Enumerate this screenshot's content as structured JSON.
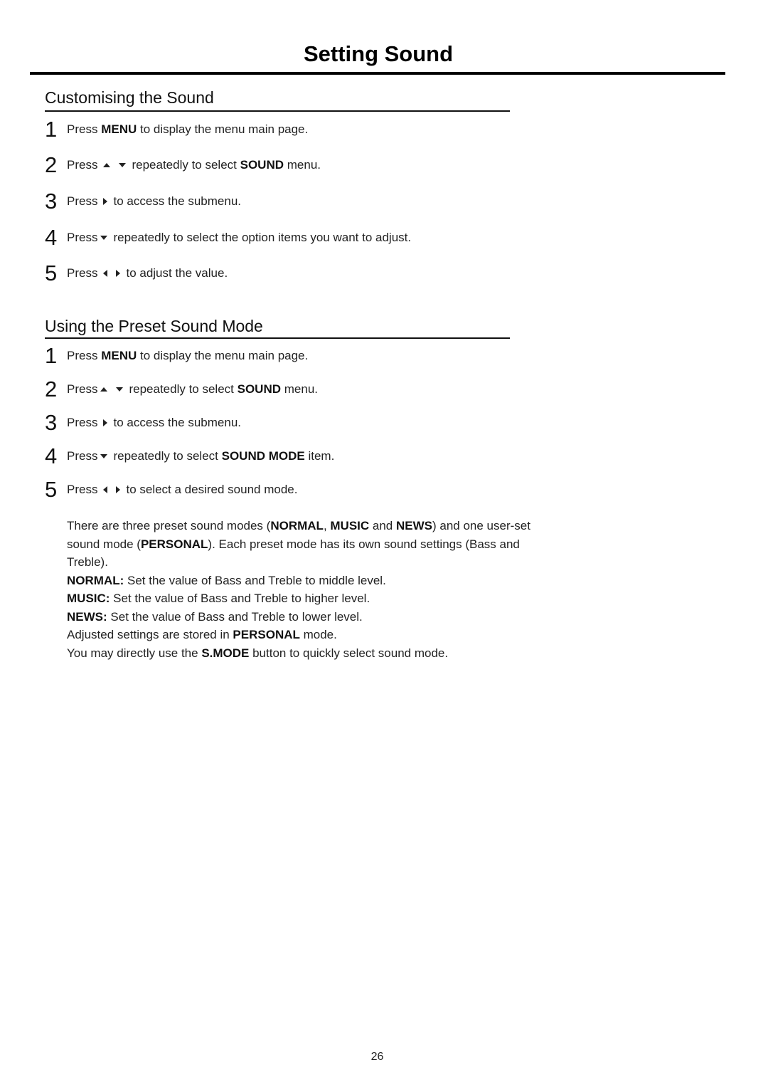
{
  "page": {
    "title": "Setting Sound",
    "page_number": "26"
  },
  "sections": [
    {
      "heading": "Customising the Sound",
      "steps": [
        {
          "num": "1",
          "pre": "Press ",
          "bold": "MENU",
          "post": " to display the menu main page.",
          "icons": []
        },
        {
          "num": "2",
          "pre": "Press",
          "icons": [
            "up-arrow-icon",
            "down-arrow-icon"
          ],
          "mid": "repeatedly to select ",
          "bold": "SOUND",
          "post": " menu."
        },
        {
          "num": "3",
          "pre": "Press",
          "icons": [
            "right-arrow-icon"
          ],
          "mid": "to access the submenu."
        },
        {
          "num": "4",
          "pre": "Press",
          "icons": [
            "down-arrow-icon"
          ],
          "mid": "repeatedly to select the option items you want to adjust."
        },
        {
          "num": "5",
          "pre": "Press",
          "icons": [
            "left-arrow-icon",
            "right-arrow-icon"
          ],
          "mid": "to adjust the value."
        }
      ]
    },
    {
      "heading": "Using the Preset Sound Mode",
      "steps": [
        {
          "num": "1",
          "pre": "Press ",
          "bold": "MENU",
          "post": " to display the menu main page.",
          "icons": []
        },
        {
          "num": "2",
          "pre": "Press",
          "icons": [
            "up-arrow-icon",
            "down-arrow-icon"
          ],
          "mid": "repeatedly to select ",
          "bold": "SOUND",
          "post": " menu."
        },
        {
          "num": "3",
          "pre": "Press",
          "icons": [
            "right-arrow-icon"
          ],
          "mid": "to access the submenu."
        },
        {
          "num": "4",
          "pre": "Press",
          "icons": [
            "down-arrow-icon"
          ],
          "mid": "repeatedly to select ",
          "bold": "SOUND MODE",
          "post": " item."
        },
        {
          "num": "5",
          "pre": "Press",
          "icons": [
            "left-arrow-icon",
            "right-arrow-icon"
          ],
          "mid": "to select a desired sound mode."
        }
      ]
    }
  ],
  "notes": {
    "intro": {
      "t1": "There are three preset sound modes (",
      "b1": "NORMAL",
      "t2": ", ",
      "b2": "MUSIC",
      "t3": " and ",
      "b3": "NEWS",
      "t4": ") and one user-set sound mode (",
      "b4": "PERSONAL",
      "t5": "). Each preset mode has its own sound settings (Bass and Treble)."
    },
    "normal": {
      "label": "NORMAL:",
      "text": " Set the value of Bass and Treble to middle level."
    },
    "music": {
      "label": "MUSIC:",
      "text": " Set the value of Bass and Treble to higher level."
    },
    "news": {
      "label": "NEWS:",
      "text": " Set the value of Bass and Treble to lower level."
    },
    "personal": {
      "t1": "Adjusted settings are stored in ",
      "bold": "PERSONAL",
      "t2": " mode."
    },
    "smode": {
      "t1": "You may directly use the ",
      "bold": "S.MODE",
      "t2": " button to quickly select sound mode."
    }
  }
}
